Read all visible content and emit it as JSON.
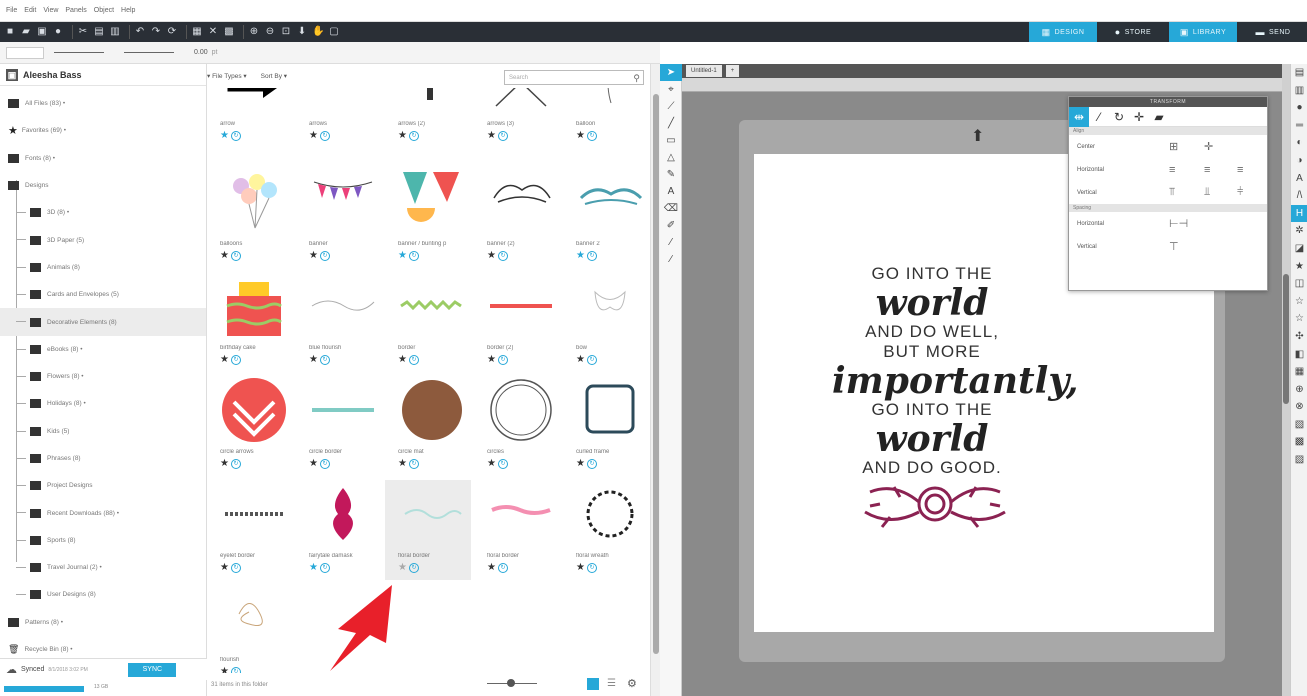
{
  "menu": [
    "File",
    "Edit",
    "View",
    "Panels",
    "Object",
    "Help"
  ],
  "tabs": {
    "design": "DESIGN",
    "store": "STORE",
    "library": "LIBRARY",
    "send": "SEND"
  },
  "subbar": {
    "value": "0.00",
    "unit": "pt"
  },
  "user": {
    "name": "Aleesha Bass"
  },
  "tree": [
    {
      "label": "All Files (83) •",
      "level": 0
    },
    {
      "label": "Favorites (69) •",
      "level": 0,
      "icon": "star"
    },
    {
      "label": "Fonts (8) •",
      "level": 0
    },
    {
      "label": "Designs",
      "level": 0
    },
    {
      "label": "3D (8) •",
      "level": 1
    },
    {
      "label": "3D Paper (5)",
      "level": 1
    },
    {
      "label": "Animals (8)",
      "level": 1
    },
    {
      "label": "Cards and Envelopes (5)",
      "level": 1
    },
    {
      "label": "Decorative Elements (8)",
      "level": 1,
      "selected": true
    },
    {
      "label": "eBooks (8) •",
      "level": 1
    },
    {
      "label": "Flowers (8) •",
      "level": 1
    },
    {
      "label": "Holidays (8) •",
      "level": 1
    },
    {
      "label": "Kids (5)",
      "level": 1
    },
    {
      "label": "Phrases (8)",
      "level": 1
    },
    {
      "label": "Project Designs",
      "level": 1
    },
    {
      "label": "Recent Downloads (88) •",
      "level": 1
    },
    {
      "label": "Sports (8)",
      "level": 1
    },
    {
      "label": "Travel Journal (2) •",
      "level": 1
    },
    {
      "label": "User Designs (8)",
      "level": 1
    },
    {
      "label": "Patterns (8) •",
      "level": 0
    },
    {
      "label": "Recycle Bin (8) •",
      "level": 0,
      "icon": "trash"
    }
  ],
  "sync": {
    "status": "Synced",
    "sub": "8/1/2018 3:02 PM",
    "button": "SYNC",
    "progress_label": "13 GB"
  },
  "content": {
    "file_types": "File Types",
    "sort_by": "Sort By",
    "search_placeholder": "Search",
    "footer": "31 items in this folder"
  },
  "items": [
    {
      "name": "arrow",
      "fav": "blue"
    },
    {
      "name": "arrows",
      "fav": "dark"
    },
    {
      "name": "arrows (2)",
      "fav": "dark"
    },
    {
      "name": "arrows (3)",
      "fav": "dark"
    },
    {
      "name": "balloon",
      "fav": "dark"
    },
    {
      "name": "balloons",
      "fav": "dark"
    },
    {
      "name": "banner",
      "fav": "dark"
    },
    {
      "name": "banner / bunting p",
      "fav": "blue"
    },
    {
      "name": "banner (2)",
      "fav": "dark"
    },
    {
      "name": "banner 2",
      "fav": "blue"
    },
    {
      "name": "birthday cake",
      "fav": "dark"
    },
    {
      "name": "blue flourish",
      "fav": "dark"
    },
    {
      "name": "border",
      "fav": "dark"
    },
    {
      "name": "border (2)",
      "fav": "dark"
    },
    {
      "name": "bow",
      "fav": "dark"
    },
    {
      "name": "circle arrows",
      "fav": "dark"
    },
    {
      "name": "circle border",
      "fav": "dark"
    },
    {
      "name": "circle mat",
      "fav": "dark"
    },
    {
      "name": "circles",
      "fav": "dark"
    },
    {
      "name": "curled frame",
      "fav": "dark"
    },
    {
      "name": "eyelet border",
      "fav": "dark"
    },
    {
      "name": "fairytale damask",
      "fav": "blue"
    },
    {
      "name": "floral border",
      "fav": "grey",
      "selected": true
    },
    {
      "name": "floral border",
      "fav": "dark"
    },
    {
      "name": "floral wreath",
      "fav": "dark"
    },
    {
      "name": "flourish",
      "fav": "dark"
    }
  ],
  "doc": {
    "tab": "Untitled-1"
  },
  "quote": {
    "l1": "GO INTO THE",
    "l2": "world",
    "l3": "AND DO WELL,",
    "l4": "BUT MORE",
    "l5": "importantly,",
    "l6": "GO INTO THE",
    "l7": "world",
    "l8": "AND DO GOOD."
  },
  "transform": {
    "title": "TRANSFORM",
    "align": "Align",
    "center": "Center",
    "horizontal": "Horizontal",
    "vertical": "Vertical",
    "spacing": "Spacing",
    "sp_horizontal": "Horizontal",
    "sp_vertical": "Vertical"
  },
  "colors": {
    "accent": "#26a8d8",
    "toolbar": "#2a2f36",
    "red": "#ef5350",
    "arrow": "#e8202a",
    "floral": "#8b2252"
  }
}
